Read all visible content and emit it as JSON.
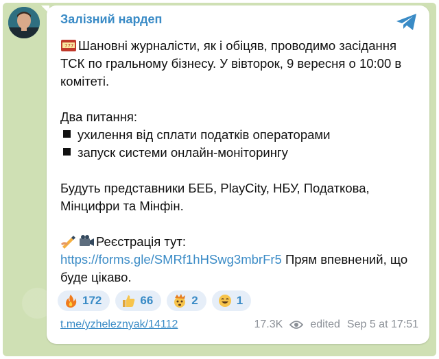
{
  "post": {
    "channel_name": "Залізний нардеп",
    "line1": "Шановні журналісти, як і обіцяв, проводимо засідання ТСК по гральному бізнесу. У вівторок, 9 вересня о 10:00 в комітеті.",
    "heading": "Два питання:",
    "bullets": [
      "ухилення від сплати податків операторами",
      "запуск системи онлайн-моніторингу"
    ],
    "attendees": "Будуть представники БЕБ, PlayCity, НБУ, Податкова, Мінцифри та Мінфін.",
    "register_label": "Реєстрація тут:",
    "register_link": "https://forms.gle/SMRf1hHSwg3mbrFr5",
    "closing": " Прям впевнений, що буде цікаво."
  },
  "reactions": [
    {
      "icon": "fire-icon",
      "count": "172"
    },
    {
      "icon": "thumbs-up-icon",
      "count": "66"
    },
    {
      "icon": "exploding-head-icon",
      "count": "2"
    },
    {
      "icon": "grinning-face-icon",
      "count": "1"
    }
  ],
  "footer": {
    "permalink": "t.me/yzheleznyak/14112",
    "views": "17.3K",
    "edited_label": "edited",
    "timestamp": "Sep 5 at 17:51"
  },
  "colors": {
    "accent": "#3a8bc6",
    "chat_background": "#cfe0b4",
    "reaction_background": "#e6eef8"
  }
}
